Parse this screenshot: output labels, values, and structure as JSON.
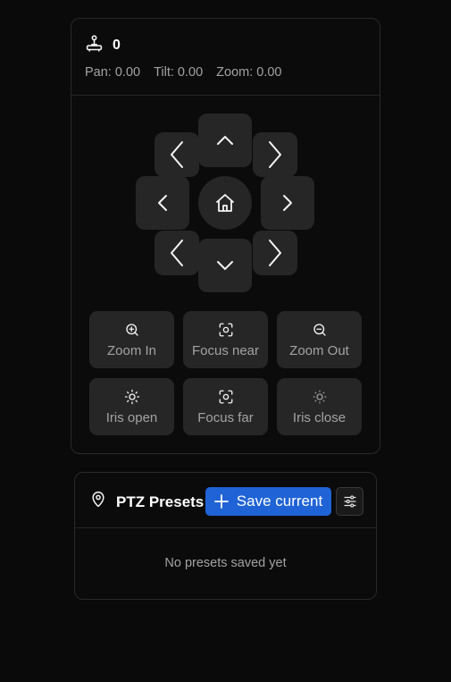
{
  "camera": {
    "id": "0",
    "pan_label": "Pan: 0.00",
    "tilt_label": "Tilt: 0.00",
    "zoom_label": "Zoom: 0.00"
  },
  "controls": {
    "zoom_in": "Zoom In",
    "focus_near": "Focus near",
    "zoom_out": "Zoom Out",
    "iris_open": "Iris open",
    "focus_far": "Focus far",
    "iris_close": "Iris close"
  },
  "presets": {
    "title": "PTZ Presets",
    "save_label": "Save current",
    "empty_message": "No presets saved yet"
  },
  "colors": {
    "background": "#0a0a0a",
    "button": "#262626",
    "accent": "#1f63d6",
    "muted_text": "#a3a3a3"
  }
}
